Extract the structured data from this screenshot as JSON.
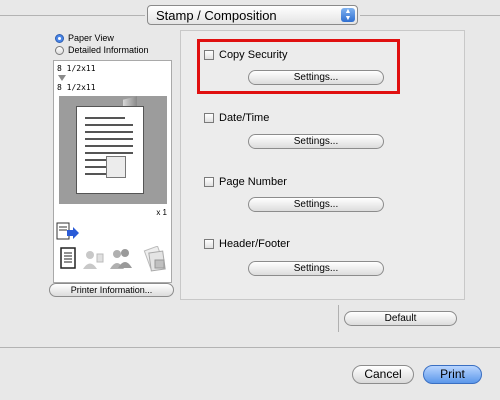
{
  "header": {
    "popup_label": "Stamp / Composition"
  },
  "left": {
    "view_options": [
      {
        "label": "Paper View",
        "selected": true
      },
      {
        "label": "Detailed Information",
        "selected": false
      }
    ],
    "original_size": "8 1/2x11",
    "output_size": "8 1/2x11",
    "copies": "x 1",
    "printer_info_label": "Printer Information..."
  },
  "options": [
    {
      "label": "Copy Security",
      "checked": false,
      "button": "Settings..."
    },
    {
      "label": "Date/Time",
      "checked": false,
      "button": "Settings..."
    },
    {
      "label": "Page Number",
      "checked": false,
      "button": "Settings..."
    },
    {
      "label": "Header/Footer",
      "checked": false,
      "button": "Settings..."
    }
  ],
  "footer": {
    "default_label": "Default",
    "cancel_label": "Cancel",
    "print_label": "Print"
  },
  "colors": {
    "highlight": "#e01010",
    "accent": "#4a86e8"
  }
}
